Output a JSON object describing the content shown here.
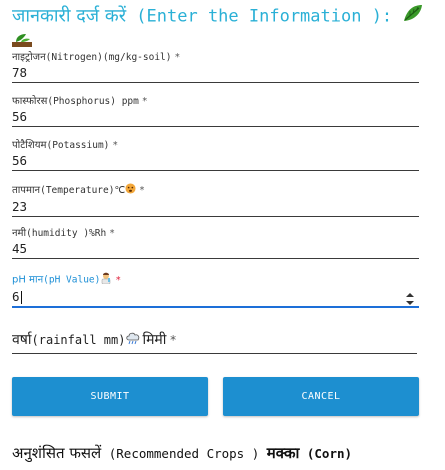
{
  "header": {
    "title_hi": "जानकारी दर्ज करें",
    "title_en": " (Enter the Information ):"
  },
  "form": {
    "fields": [
      {
        "label_hi": "नाइट्रोजन",
        "label_en": "(Nitrogen)(mg/kg-soil)",
        "value": "78"
      },
      {
        "label_hi": "फास्फोरस",
        "label_en": "(Phosphorus) ppm",
        "value": "56"
      },
      {
        "label_hi": "पोटैशियम",
        "label_en": "(Potassium)",
        "value": "56"
      },
      {
        "label_hi": "तापमान",
        "label_en": "(Temperature)℃",
        "value": "23"
      },
      {
        "label_hi": "नमी",
        "label_en": "(humidity )%Rh",
        "value": "45"
      },
      {
        "label_hi": "pH मान",
        "label_en": "(pH Value)",
        "value": "6"
      }
    ],
    "required_mark": "*",
    "rainfall": {
      "label_hi": "वर्षा",
      "label_en": "(rainfall mm)",
      "label_hi2": "मिमी"
    }
  },
  "buttons": {
    "submit": "SUBMIT",
    "cancel": "CANCEL"
  },
  "result": {
    "label_hi": "अनुशंसित फसलें",
    "label_en": " (Recommended Crops )",
    "crop_hi": "मक्का",
    "crop_en": " (Corn)"
  },
  "icons": [
    "leaf-icon",
    "sprout-icon",
    "hot-face-icon",
    "scientist-icon",
    "rain-cloud-icon",
    "spinner-arrows-icon"
  ],
  "colors": {
    "accent": "#1d8fd0",
    "title": "#2ab0d6",
    "active_underline": "#1d6fd8",
    "required_active": "#e0203b"
  }
}
